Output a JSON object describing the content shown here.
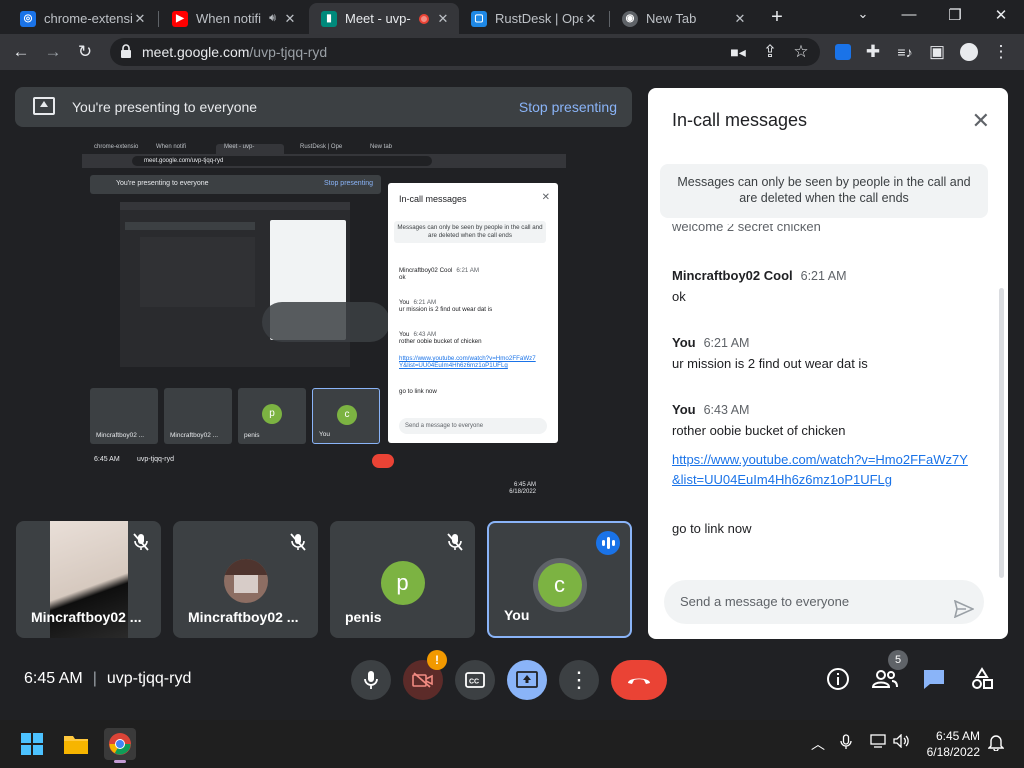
{
  "browser": {
    "tabs": [
      {
        "title": "chrome-extensio",
        "icon": "extension-tab-icon"
      },
      {
        "title": "When notifi",
        "icon": "youtube-icon"
      },
      {
        "title": "Meet - uvp-",
        "icon": "meet-icon"
      },
      {
        "title": "RustDesk | Ope",
        "icon": "rustdesk-icon"
      },
      {
        "title": "New Tab",
        "icon": "chrome-icon"
      }
    ],
    "url_host": "meet.google.com",
    "url_path": "/uvp-tjqq-ryd"
  },
  "presenting": {
    "text": "You're presenting to everyone",
    "stop": "Stop presenting"
  },
  "preview": {
    "tabs": [
      "chrome-extensio",
      "When notifi",
      "Meet - uvp-",
      "RustDesk | Ope",
      "New tab"
    ],
    "url": "meet.google.com/uvp-tjqq-ryd",
    "presenting": "You're presenting to everyone",
    "stop": "Stop presenting",
    "chat_title": "In-call messages",
    "chat_note": "Messages can only be seen by people in the call and are deleted when the call ends",
    "messages": [
      {
        "sender": "Mincraftboy02 Cool",
        "time": "6:21 AM",
        "text": "ok"
      },
      {
        "sender": "You",
        "time": "6:21 AM",
        "text": "ur mission is 2 find out wear dat is"
      },
      {
        "sender": "You",
        "time": "6:43 AM",
        "text": "rother oobie bucket of chicken"
      }
    ],
    "link": "https://www.youtube.com/watch?v=Hmo2FFaWz7Y&list=UU04EuIm4Hh6z6mz1oP1UFLg",
    "last": "go to link now",
    "input": "Send a message to everyone",
    "tiles": [
      "Mincraftboy02 ...",
      "Mincraftboy02 ...",
      "penis",
      "You"
    ],
    "time": "6:45 AM",
    "code": "uvp-tjqq-ryd",
    "clock": "6:45 AM",
    "date": "6/18/2022"
  },
  "participants": [
    {
      "name": "Mincraftboy02 ...",
      "muted": true,
      "type": "camera"
    },
    {
      "name": "Mincraftboy02 ...",
      "muted": true,
      "type": "avatar-image"
    },
    {
      "name": "penis",
      "muted": true,
      "initial": "p"
    },
    {
      "name": "You",
      "muted": false,
      "initial": "c",
      "speaking": true
    }
  ],
  "chat": {
    "title": "In-call messages",
    "note": "Messages can only be seen by people in the call and are deleted when the call ends",
    "partial_message": "welcome 2 secret chicken",
    "messages": [
      {
        "sender": "Mincraftboy02 Cool",
        "time": "6:21 AM",
        "text": "ok"
      },
      {
        "sender": "You",
        "time": "6:21 AM",
        "text": "ur mission is 2 find out wear dat is"
      },
      {
        "sender": "You",
        "time": "6:43 AM",
        "text": "rother oobie bucket of chicken"
      }
    ],
    "link": "https://www.youtube.com/watch?v=Hmo2FFaWz7Y&list=UU04EuIm4Hh6z6mz1oP1UFLg",
    "last_message": "go to link now",
    "input_placeholder": "Send a message to everyone"
  },
  "meeting": {
    "time": "6:45 AM",
    "code": "uvp-tjqq-ryd",
    "camera_alert": "!",
    "people_count": "5"
  },
  "taskbar": {
    "time": "6:45 AM",
    "date": "6/18/2022"
  },
  "colors": {
    "accent": "#8ab4f8",
    "end_call": "#ea4335",
    "avatar": "#7cb342",
    "speaking": "#1a73e8"
  }
}
